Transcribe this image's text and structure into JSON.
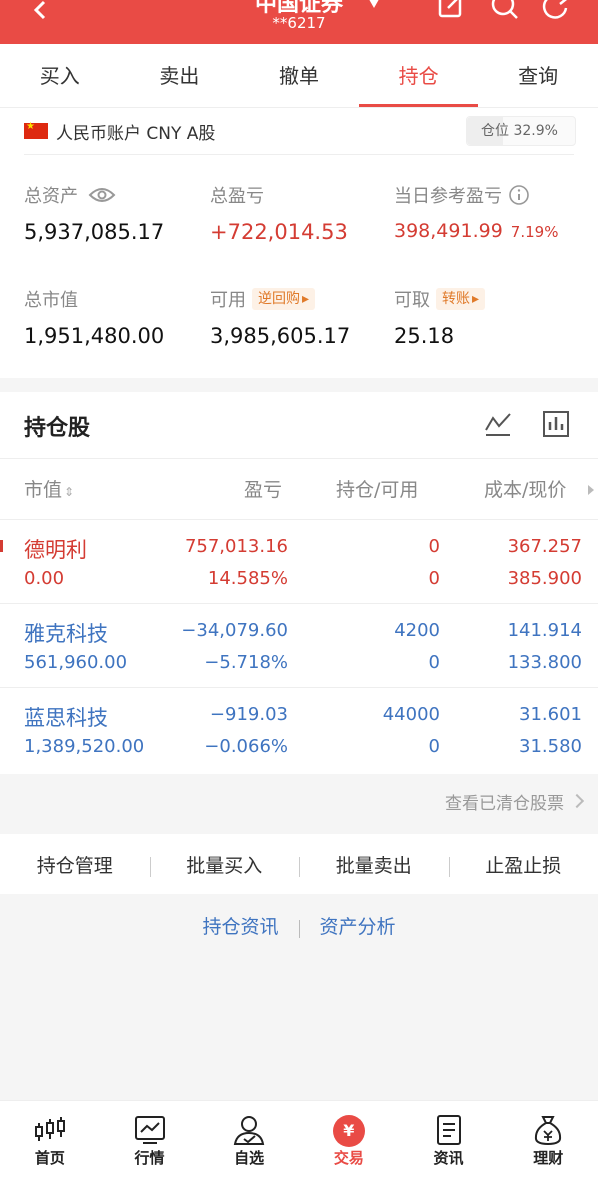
{
  "header": {
    "title": "中国证券",
    "account_masked": "**6217",
    "colors": {
      "primary": "#e94b45"
    }
  },
  "tabs": [
    {
      "label": "买入"
    },
    {
      "label": "卖出"
    },
    {
      "label": "撤单"
    },
    {
      "label": "持仓",
      "active": true
    },
    {
      "label": "查询"
    }
  ],
  "account": {
    "label": "人民币账户 CNY A股",
    "position_ratio_label": "仓位 32.9%",
    "position_ratio": 0.329,
    "total_assets_label": "总资产",
    "total_assets": "5,937,085.17",
    "total_pnl_label": "总盈亏",
    "total_pnl": "+722,014.53",
    "today_pnl_label": "当日参考盈亏",
    "today_pnl": "398,491.99",
    "today_pnl_pct": "7.19%",
    "market_value_label": "总市值",
    "market_value": "1,951,480.00",
    "available_label": "可用",
    "available_tag": "逆回购",
    "available": "3,985,605.17",
    "withdrawable_label": "可取",
    "withdrawable_tag": "转账",
    "withdrawable": "25.18"
  },
  "holdings": {
    "title": "持仓股",
    "columns": [
      "市值",
      "盈亏",
      "持仓/可用",
      "成本/现价"
    ],
    "rows": [
      {
        "name": "德明利",
        "market_value": "0.00",
        "pnl": "757,013.16",
        "pnl_pct": "14.585%",
        "position": "0",
        "available": "0",
        "cost": "367.257",
        "price": "385.900",
        "color": "red"
      },
      {
        "name": "雅克科技",
        "market_value": "561,960.00",
        "pnl": "−34,079.60",
        "pnl_pct": "−5.718%",
        "position": "4200",
        "available": "0",
        "cost": "141.914",
        "price": "133.800",
        "color": "blue"
      },
      {
        "name": "蓝思科技",
        "market_value": "1,389,520.00",
        "pnl": "−919.03",
        "pnl_pct": "−0.066%",
        "position": "44000",
        "available": "0",
        "cost": "31.601",
        "price": "31.580",
        "color": "blue"
      }
    ]
  },
  "cleared_link": "查看已清仓股票",
  "actions": [
    "持仓管理",
    "批量买入",
    "批量卖出",
    "止盈止损"
  ],
  "links": [
    "持仓资讯",
    "资产分析"
  ],
  "bottom_nav": [
    {
      "label": "首页",
      "icon": "candlestick-icon"
    },
    {
      "label": "行情",
      "icon": "chart-line-icon"
    },
    {
      "label": "自选",
      "icon": "user-check-icon"
    },
    {
      "label": "交易",
      "icon": "yuan-icon",
      "active": true
    },
    {
      "label": "资讯",
      "icon": "document-icon"
    },
    {
      "label": "理财",
      "icon": "money-bag-icon"
    }
  ]
}
